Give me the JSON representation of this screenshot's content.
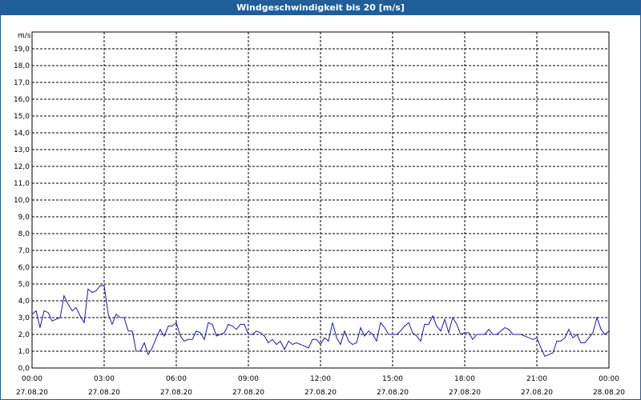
{
  "window": {
    "title": "Windgeschwindigkeit bis 20 [m/s]"
  },
  "colors": {
    "titlebar": "#1e5e9a",
    "series": "#1a1aa8",
    "grid": "#000000"
  },
  "chart_data": {
    "type": "line",
    "title": "Windgeschwindigkeit bis 20 [m/s]",
    "ylabel": "m/s",
    "xlabel": "",
    "ylim": [
      0,
      20
    ],
    "y_ticks": [
      "0,0",
      "1,0",
      "2,0",
      "3,0",
      "4,0",
      "5,0",
      "6,0",
      "7,0",
      "8,0",
      "9,0",
      "10,0",
      "11,0",
      "12,0",
      "13,0",
      "14,0",
      "15,0",
      "16,0",
      "17,0",
      "18,0",
      "19,0"
    ],
    "x_ticks": [
      {
        "time": "00:00",
        "date": "27.08.20"
      },
      {
        "time": "03:00",
        "date": "27.08.20"
      },
      {
        "time": "06:00",
        "date": "27.08.20"
      },
      {
        "time": "09:00",
        "date": "27.08.20"
      },
      {
        "time": "12:00",
        "date": "27.08.20"
      },
      {
        "time": "15:00",
        "date": "27.08.20"
      },
      {
        "time": "18:00",
        "date": "27.08.20"
      },
      {
        "time": "21:00",
        "date": "27.08.20"
      },
      {
        "time": "00:00",
        "date": "28.08.20"
      }
    ],
    "xlim_hours": [
      0,
      24
    ],
    "grid": true,
    "legend": "none",
    "series": [
      {
        "x_hours": [
          0.0,
          0.17,
          0.33,
          0.5,
          0.67,
          0.83,
          1.0,
          1.17,
          1.33,
          1.5,
          1.67,
          1.83,
          2.0,
          2.17,
          2.33,
          2.5,
          2.67,
          2.83,
          3.0,
          3.17,
          3.33,
          3.5,
          3.67,
          3.83,
          4.0,
          4.17,
          4.33,
          4.5,
          4.67,
          4.83,
          5.0,
          5.17,
          5.33,
          5.5,
          5.67,
          5.83,
          6.0,
          6.17,
          6.33,
          6.5,
          6.67,
          6.83,
          7.0,
          7.17,
          7.33,
          7.5,
          7.67,
          7.83,
          8.0,
          8.17,
          8.33,
          8.5,
          8.67,
          8.83,
          9.0,
          9.17,
          9.33,
          9.5,
          9.67,
          9.83,
          10.0,
          10.17,
          10.33,
          10.5,
          10.67,
          10.83,
          11.0,
          11.17,
          11.33,
          11.5,
          11.67,
          11.83,
          12.0,
          12.17,
          12.33,
          12.5,
          12.67,
          12.83,
          13.0,
          13.17,
          13.33,
          13.5,
          13.67,
          13.83,
          14.0,
          14.17,
          14.33,
          14.5,
          14.67,
          14.83,
          15.0,
          15.17,
          15.33,
          15.5,
          15.67,
          15.83,
          16.0,
          16.17,
          16.33,
          16.5,
          16.67,
          16.83,
          17.0,
          17.17,
          17.33,
          17.5,
          17.67,
          17.83,
          18.0,
          18.17,
          18.33,
          18.5,
          18.67,
          18.83,
          19.0,
          19.17,
          19.33,
          19.5,
          19.67,
          19.83,
          20.0,
          20.17,
          20.33,
          20.5,
          20.67,
          20.83,
          21.0,
          21.17,
          21.33,
          21.5,
          21.67,
          21.83,
          22.0,
          22.17,
          22.33,
          22.5,
          22.67,
          22.83,
          23.0,
          23.17,
          23.33,
          23.5,
          23.67,
          23.83,
          24.0
        ],
        "values": [
          3.2,
          3.4,
          2.4,
          3.4,
          3.3,
          2.8,
          2.9,
          3.0,
          4.3,
          3.8,
          3.4,
          3.6,
          3.1,
          2.7,
          4.7,
          4.5,
          4.6,
          4.9,
          4.9,
          3.2,
          2.6,
          3.2,
          3.0,
          3.0,
          2.2,
          2.2,
          1.0,
          1.0,
          1.5,
          0.8,
          1.2,
          1.8,
          2.3,
          1.9,
          2.5,
          2.5,
          2.7,
          1.9,
          1.6,
          1.7,
          1.7,
          2.2,
          2.1,
          1.7,
          2.7,
          2.6,
          1.9,
          2.0,
          2.1,
          2.6,
          2.5,
          2.3,
          2.6,
          2.6,
          2.0,
          2.0,
          2.2,
          2.1,
          1.9,
          1.5,
          1.7,
          1.4,
          1.6,
          1.1,
          1.6,
          1.4,
          1.5,
          1.4,
          1.3,
          1.2,
          1.7,
          1.7,
          1.4,
          1.8,
          1.6,
          2.7,
          1.8,
          1.4,
          2.2,
          1.6,
          1.4,
          1.5,
          2.4,
          1.9,
          2.2,
          2.0,
          1.6,
          2.7,
          2.4,
          2.0,
          2.0,
          2.0,
          2.2,
          2.5,
          2.7,
          2.1,
          1.9,
          1.6,
          2.6,
          2.6,
          3.1,
          2.5,
          2.2,
          2.9,
          2.1,
          3.0,
          2.6,
          2.0,
          2.1,
          2.1,
          1.7,
          2.0,
          2.0,
          2.0,
          2.3,
          2.0,
          2.0,
          2.2,
          2.4,
          2.3,
          2.0,
          2.0,
          2.0,
          1.9,
          1.8,
          1.7,
          1.8,
          1.2,
          0.7,
          0.8,
          0.9,
          1.6,
          1.6,
          1.8,
          2.3,
          1.8,
          2.0,
          1.5,
          1.5,
          1.8,
          2.1,
          3.0,
          2.3,
          2.0,
          2.2
        ]
      }
    ]
  }
}
